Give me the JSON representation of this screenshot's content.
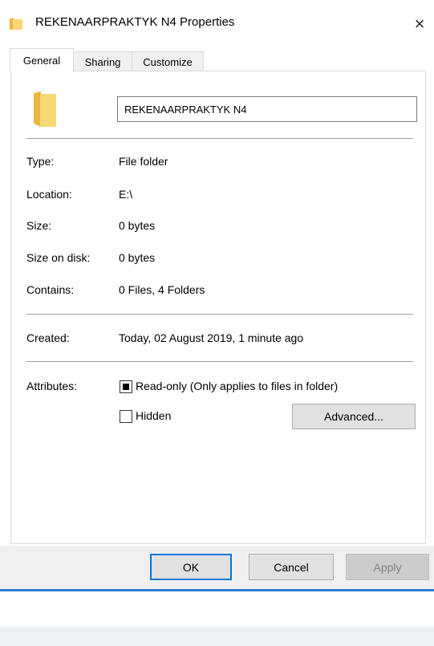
{
  "window": {
    "title": "REKENAARPRAKTYK N4 Properties",
    "close_glyph": "×",
    "accent_color": "#0078d7",
    "folder_color": "#f8d775"
  },
  "tabs": [
    {
      "label": "General",
      "active": true
    },
    {
      "label": "Sharing",
      "active": false
    },
    {
      "label": "Customize",
      "active": false
    }
  ],
  "general": {
    "folder_icon": "folder-icon",
    "name_value": "REKENAARPRAKTYK N4",
    "type": {
      "label": "Type:",
      "value": "File folder"
    },
    "location": {
      "label": "Location:",
      "value": "E:\\"
    },
    "size": {
      "label": "Size:",
      "value": "0 bytes"
    },
    "size_on_disk": {
      "label": "Size on disk:",
      "value": "0 bytes"
    },
    "contains": {
      "label": "Contains:",
      "value": "0 Files, 4 Folders"
    },
    "created": {
      "label": "Created:",
      "value": "Today, 02 August 2019, 1 minute ago"
    },
    "attributes": {
      "label": "Attributes:",
      "read_only": {
        "label": "Read-only (Only applies to files in folder)",
        "state": "indeterminate"
      },
      "hidden": {
        "label": "Hidden",
        "state": "unchecked"
      },
      "advanced_label": "Advanced..."
    }
  },
  "buttons": {
    "ok": "OK",
    "cancel": "Cancel",
    "apply": "Apply"
  }
}
